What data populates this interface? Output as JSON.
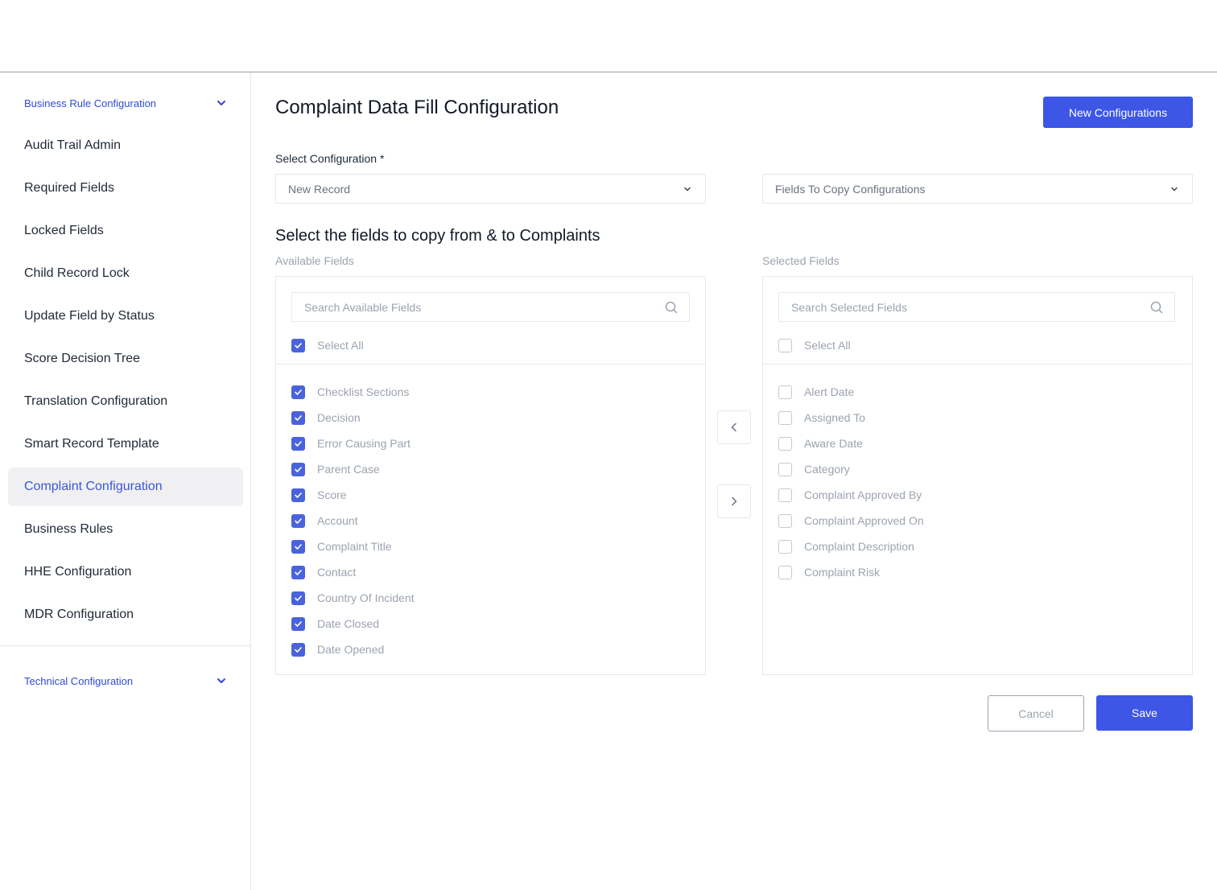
{
  "sidebar": {
    "sections": [
      {
        "label": "Business Rule Configuration",
        "icon": "chevron-down-icon"
      },
      {
        "label": "Technical Configuration",
        "icon": "chevron-down-icon"
      }
    ],
    "items": [
      {
        "label": "Audit Trail Admin",
        "active": false
      },
      {
        "label": "Required Fields",
        "active": false
      },
      {
        "label": "Locked Fields",
        "active": false
      },
      {
        "label": "Child Record Lock",
        "active": false
      },
      {
        "label": "Update Field by Status",
        "active": false
      },
      {
        "label": "Score Decision Tree",
        "active": false
      },
      {
        "label": "Translation Configuration",
        "active": false
      },
      {
        "label": "Smart Record Template",
        "active": false
      },
      {
        "label": "Complaint Configuration",
        "active": true
      },
      {
        "label": "Business Rules",
        "active": false
      },
      {
        "label": "HHE Configuration",
        "active": false
      },
      {
        "label": "MDR Configuration",
        "active": false
      }
    ]
  },
  "main": {
    "title": "Complaint Data Fill Configuration",
    "new_button": "New Configurations",
    "select_label": "Select Configuration *",
    "select_value": "New Record",
    "copy_select_value": "Fields To Copy Configurations",
    "section_title": "Select the fields to copy from & to Complaints",
    "available": {
      "label": "Available Fields",
      "search_placeholder": "Search Available Fields",
      "select_all": "Select All",
      "select_all_checked": true,
      "items": [
        {
          "label": "Checklist Sections",
          "checked": true
        },
        {
          "label": "Decision",
          "checked": true
        },
        {
          "label": "Error Causing Part",
          "checked": true
        },
        {
          "label": "Parent Case",
          "checked": true
        },
        {
          "label": "Score",
          "checked": true
        },
        {
          "label": "Account",
          "checked": true
        },
        {
          "label": "Complaint Title",
          "checked": true
        },
        {
          "label": "Contact",
          "checked": true
        },
        {
          "label": "Country Of Incident",
          "checked": true
        },
        {
          "label": "Date Closed",
          "checked": true
        },
        {
          "label": "Date Opened",
          "checked": true
        }
      ]
    },
    "selected": {
      "label": "Selected Fields",
      "search_placeholder": "Search Selected Fields",
      "select_all": "Select All",
      "select_all_checked": false,
      "items": [
        {
          "label": "Alert Date",
          "checked": false
        },
        {
          "label": "Assigned To",
          "checked": false
        },
        {
          "label": "Aware Date",
          "checked": false
        },
        {
          "label": "Category",
          "checked": false
        },
        {
          "label": "Complaint Approved By",
          "checked": false
        },
        {
          "label": "Complaint Approved On",
          "checked": false
        },
        {
          "label": "Complaint Description",
          "checked": false
        },
        {
          "label": "Complaint Risk",
          "checked": false
        }
      ]
    },
    "cancel": "Cancel",
    "save": "Save"
  },
  "colors": {
    "accent": "#3d56e6",
    "checkbox": "#4a63dc",
    "active_nav_bg": "#f0f0f2",
    "active_nav_text": "#3b56d6",
    "section_link": "#2f4bd8"
  }
}
